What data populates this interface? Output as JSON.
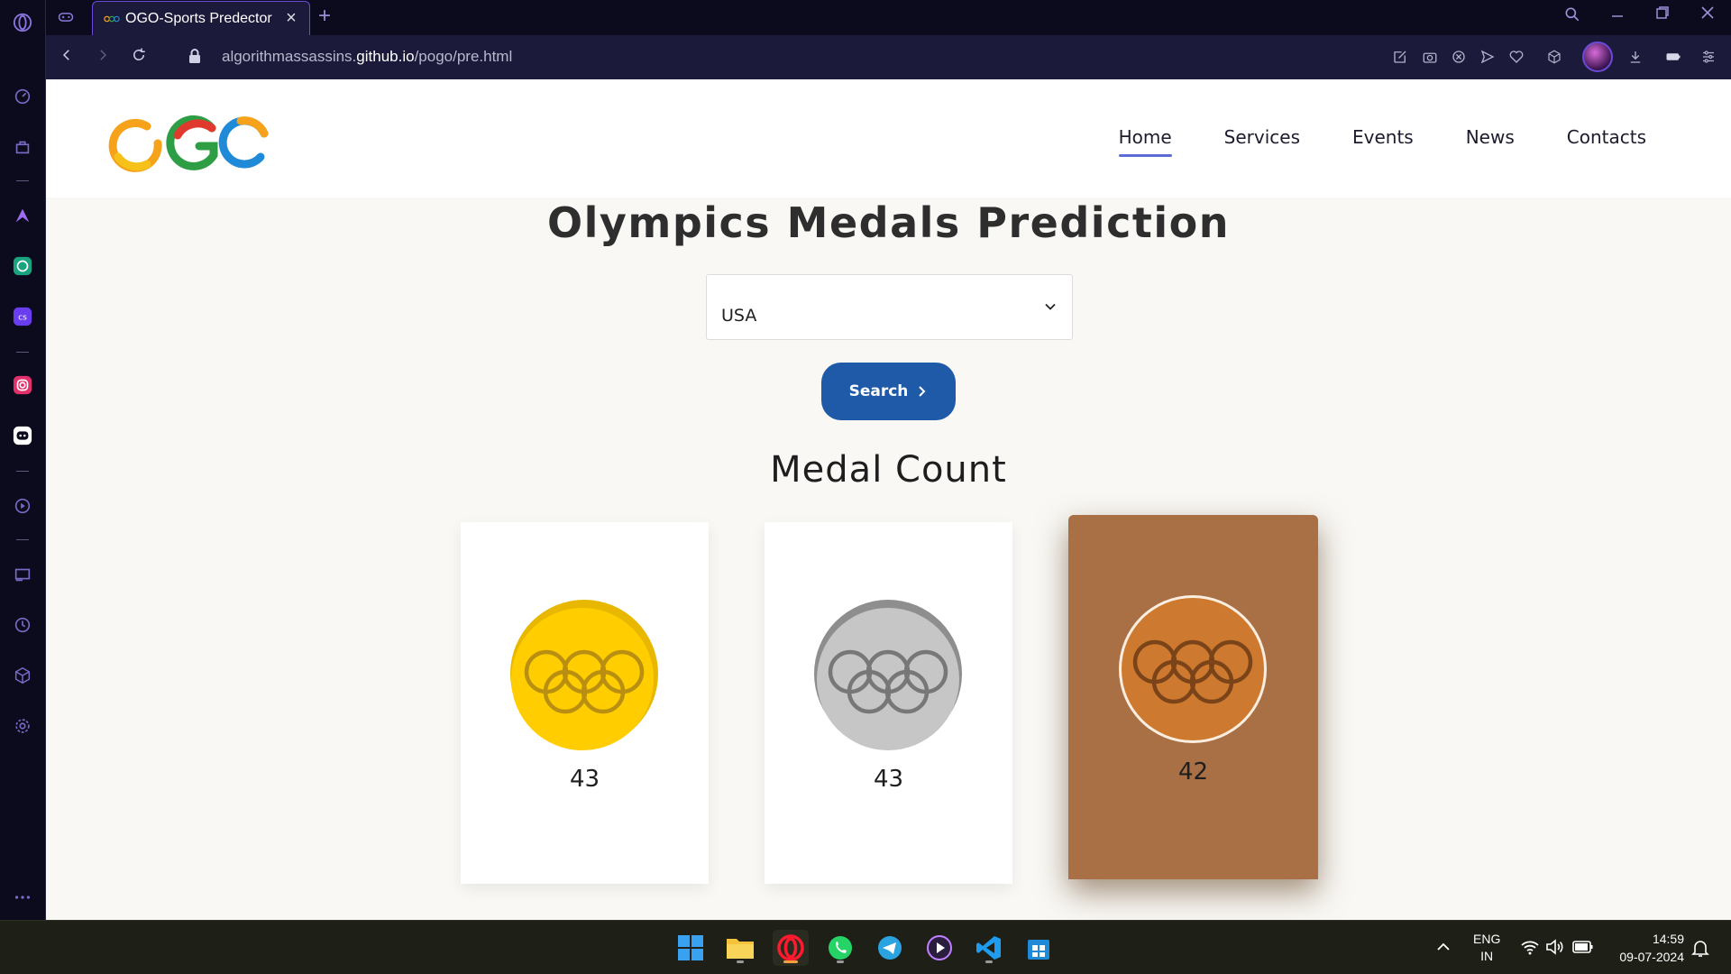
{
  "browser": {
    "tab_title": "OGO-Sports Predector",
    "url_prefix": "algorithmassassins.",
    "url_domain": "github.io",
    "url_path": "/pogo/pre.html"
  },
  "site": {
    "logo_text": "OGO",
    "nav": [
      {
        "label": "Home",
        "active": true
      },
      {
        "label": "Services",
        "active": false
      },
      {
        "label": "Events",
        "active": false
      },
      {
        "label": "News",
        "active": false
      },
      {
        "label": "Contacts",
        "active": false
      }
    ]
  },
  "main": {
    "title": "Olympics Medals Prediction",
    "country_select": {
      "value": "USA"
    },
    "search_label": "Search",
    "medal_heading": "Medal Count",
    "medals": [
      {
        "type": "gold",
        "count": "43",
        "color": "#ffcd00"
      },
      {
        "type": "silver",
        "count": "43",
        "color": "#c6c6c6"
      },
      {
        "type": "bronze",
        "count": "42",
        "color": "#cd7a30"
      }
    ]
  },
  "taskbar": {
    "lang": "ENG",
    "region": "IN",
    "time": "14:59",
    "date": "09-07-2024"
  }
}
